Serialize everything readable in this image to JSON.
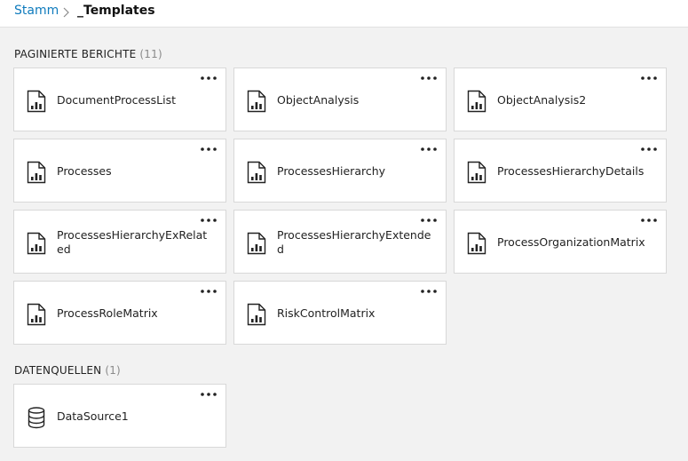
{
  "breadcrumb": {
    "root": "Stamm",
    "current": "_Templates"
  },
  "sections": [
    {
      "title": "PAGINIERTE BERICHTE",
      "count": "(11)",
      "icon": "paginated-report-icon",
      "items": [
        {
          "name": "DocumentProcessList"
        },
        {
          "name": "ObjectAnalysis"
        },
        {
          "name": "ObjectAnalysis2"
        },
        {
          "name": "Processes"
        },
        {
          "name": "ProcessesHierarchy"
        },
        {
          "name": "ProcessesHierarchyDetails"
        },
        {
          "name": "ProcessesHierarchyExRelated"
        },
        {
          "name": "ProcessesHierarchyExtended"
        },
        {
          "name": "ProcessOrganizationMatrix"
        },
        {
          "name": "ProcessRoleMatrix"
        },
        {
          "name": "RiskControlMatrix"
        }
      ]
    },
    {
      "title": "DATENQUELLEN",
      "count": "(1)",
      "icon": "database-icon",
      "items": [
        {
          "name": "DataSource1"
        }
      ]
    }
  ],
  "colors": {
    "accent": "#0f7bbd",
    "background": "#f2f2f2",
    "tile": "#ffffff",
    "border": "#d8d8d8"
  }
}
